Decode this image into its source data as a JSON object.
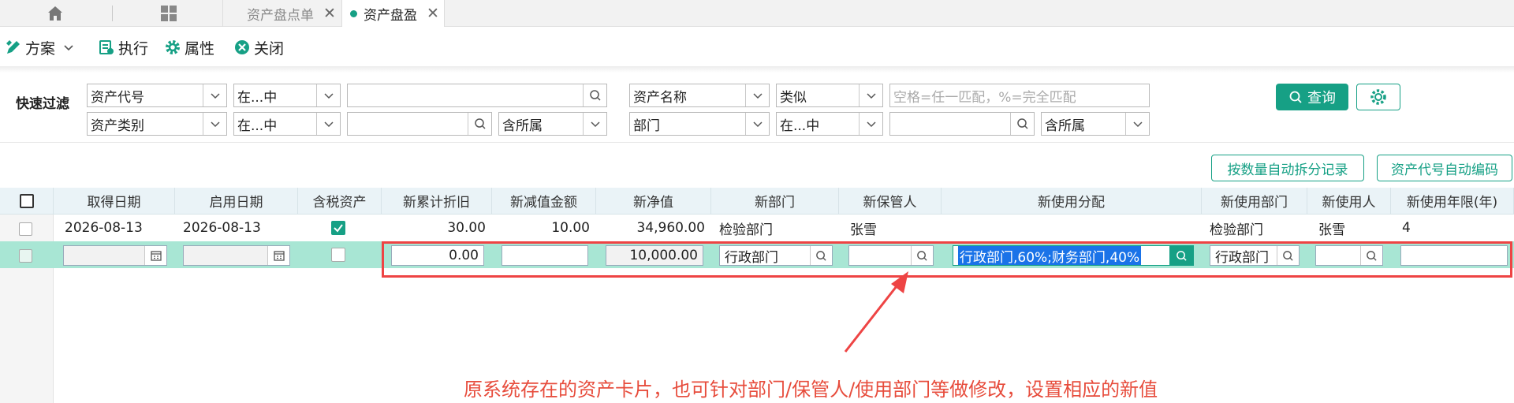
{
  "tabs": {
    "home_icon": "home-icon",
    "apps_icon": "grid-icon",
    "items": [
      {
        "label": "资产盘点单",
        "active": false
      },
      {
        "label": "资产盘盈",
        "active": true
      }
    ],
    "close_glyph": "✕"
  },
  "toolbar": {
    "plan": "方案",
    "execute": "执行",
    "properties": "属性",
    "close": "关闭"
  },
  "filter": {
    "label": "快速过滤",
    "row1": {
      "field1": "资产代号",
      "op1": "在...中",
      "value1": "",
      "field2": "资产名称",
      "op2": "类似",
      "value2_placeholder": "空格=任一匹配，%=完全匹配"
    },
    "row2": {
      "field1": "资产类别",
      "op1": "在...中",
      "value1": "",
      "sub1": "含所属",
      "field2": "部门",
      "op2": "在...中",
      "value2": "",
      "sub2": "含所属"
    },
    "query_button": "查询"
  },
  "actions": {
    "split_button": "按数量自动拆分记录",
    "autocode_button": "资产代号自动编码"
  },
  "grid": {
    "columns": [
      "取得日期",
      "启用日期",
      "含税资产",
      "新累计折旧",
      "新减值金额",
      "新净值",
      "新部门",
      "新保管人",
      "新使用分配",
      "新使用部门",
      "新使用人",
      "新使用年限(年)"
    ],
    "row1": {
      "acquire_date": "2026-08-13",
      "start_date": "2026-08-13",
      "tax_included": true,
      "acc_depr": "30.00",
      "impairment": "10.00",
      "net_value": "34,960.00",
      "dept": "检验部门",
      "custodian": "张雪",
      "allocation": "",
      "use_dept": "检验部门",
      "user": "张雪",
      "years": "4"
    },
    "row2": {
      "acc_depr": "0.00",
      "impairment": "",
      "net_value": "10,000.00",
      "dept": "行政部门",
      "custodian": "",
      "allocation": "行政部门,60%;财务部门,40%",
      "use_dept": "行政部门",
      "user": "",
      "years": ""
    }
  },
  "annotation": "原系统存在的资产卡片，也可针对部门/保管人/使用部门等做修改，设置相应的新值",
  "colors": {
    "accent": "#16a085",
    "annotation": "#e74c3c",
    "selected_row": "#a8e6d4"
  }
}
